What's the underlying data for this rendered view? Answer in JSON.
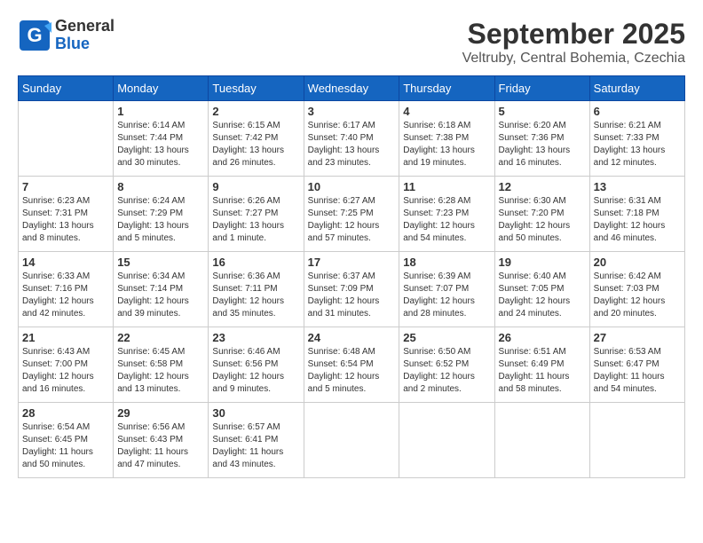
{
  "header": {
    "logo_general": "General",
    "logo_blue": "Blue",
    "month_title": "September 2025",
    "location": "Veltruby, Central Bohemia, Czechia"
  },
  "calendar": {
    "days_of_week": [
      "Sunday",
      "Monday",
      "Tuesday",
      "Wednesday",
      "Thursday",
      "Friday",
      "Saturday"
    ],
    "weeks": [
      [
        {
          "day": "",
          "info": ""
        },
        {
          "day": "1",
          "info": "Sunrise: 6:14 AM\nSunset: 7:44 PM\nDaylight: 13 hours\nand 30 minutes."
        },
        {
          "day": "2",
          "info": "Sunrise: 6:15 AM\nSunset: 7:42 PM\nDaylight: 13 hours\nand 26 minutes."
        },
        {
          "day": "3",
          "info": "Sunrise: 6:17 AM\nSunset: 7:40 PM\nDaylight: 13 hours\nand 23 minutes."
        },
        {
          "day": "4",
          "info": "Sunrise: 6:18 AM\nSunset: 7:38 PM\nDaylight: 13 hours\nand 19 minutes."
        },
        {
          "day": "5",
          "info": "Sunrise: 6:20 AM\nSunset: 7:36 PM\nDaylight: 13 hours\nand 16 minutes."
        },
        {
          "day": "6",
          "info": "Sunrise: 6:21 AM\nSunset: 7:33 PM\nDaylight: 13 hours\nand 12 minutes."
        }
      ],
      [
        {
          "day": "7",
          "info": "Sunrise: 6:23 AM\nSunset: 7:31 PM\nDaylight: 13 hours\nand 8 minutes."
        },
        {
          "day": "8",
          "info": "Sunrise: 6:24 AM\nSunset: 7:29 PM\nDaylight: 13 hours\nand 5 minutes."
        },
        {
          "day": "9",
          "info": "Sunrise: 6:26 AM\nSunset: 7:27 PM\nDaylight: 13 hours\nand 1 minute."
        },
        {
          "day": "10",
          "info": "Sunrise: 6:27 AM\nSunset: 7:25 PM\nDaylight: 12 hours\nand 57 minutes."
        },
        {
          "day": "11",
          "info": "Sunrise: 6:28 AM\nSunset: 7:23 PM\nDaylight: 12 hours\nand 54 minutes."
        },
        {
          "day": "12",
          "info": "Sunrise: 6:30 AM\nSunset: 7:20 PM\nDaylight: 12 hours\nand 50 minutes."
        },
        {
          "day": "13",
          "info": "Sunrise: 6:31 AM\nSunset: 7:18 PM\nDaylight: 12 hours\nand 46 minutes."
        }
      ],
      [
        {
          "day": "14",
          "info": "Sunrise: 6:33 AM\nSunset: 7:16 PM\nDaylight: 12 hours\nand 42 minutes."
        },
        {
          "day": "15",
          "info": "Sunrise: 6:34 AM\nSunset: 7:14 PM\nDaylight: 12 hours\nand 39 minutes."
        },
        {
          "day": "16",
          "info": "Sunrise: 6:36 AM\nSunset: 7:11 PM\nDaylight: 12 hours\nand 35 minutes."
        },
        {
          "day": "17",
          "info": "Sunrise: 6:37 AM\nSunset: 7:09 PM\nDaylight: 12 hours\nand 31 minutes."
        },
        {
          "day": "18",
          "info": "Sunrise: 6:39 AM\nSunset: 7:07 PM\nDaylight: 12 hours\nand 28 minutes."
        },
        {
          "day": "19",
          "info": "Sunrise: 6:40 AM\nSunset: 7:05 PM\nDaylight: 12 hours\nand 24 minutes."
        },
        {
          "day": "20",
          "info": "Sunrise: 6:42 AM\nSunset: 7:03 PM\nDaylight: 12 hours\nand 20 minutes."
        }
      ],
      [
        {
          "day": "21",
          "info": "Sunrise: 6:43 AM\nSunset: 7:00 PM\nDaylight: 12 hours\nand 16 minutes."
        },
        {
          "day": "22",
          "info": "Sunrise: 6:45 AM\nSunset: 6:58 PM\nDaylight: 12 hours\nand 13 minutes."
        },
        {
          "day": "23",
          "info": "Sunrise: 6:46 AM\nSunset: 6:56 PM\nDaylight: 12 hours\nand 9 minutes."
        },
        {
          "day": "24",
          "info": "Sunrise: 6:48 AM\nSunset: 6:54 PM\nDaylight: 12 hours\nand 5 minutes."
        },
        {
          "day": "25",
          "info": "Sunrise: 6:50 AM\nSunset: 6:52 PM\nDaylight: 12 hours\nand 2 minutes."
        },
        {
          "day": "26",
          "info": "Sunrise: 6:51 AM\nSunset: 6:49 PM\nDaylight: 11 hours\nand 58 minutes."
        },
        {
          "day": "27",
          "info": "Sunrise: 6:53 AM\nSunset: 6:47 PM\nDaylight: 11 hours\nand 54 minutes."
        }
      ],
      [
        {
          "day": "28",
          "info": "Sunrise: 6:54 AM\nSunset: 6:45 PM\nDaylight: 11 hours\nand 50 minutes."
        },
        {
          "day": "29",
          "info": "Sunrise: 6:56 AM\nSunset: 6:43 PM\nDaylight: 11 hours\nand 47 minutes."
        },
        {
          "day": "30",
          "info": "Sunrise: 6:57 AM\nSunset: 6:41 PM\nDaylight: 11 hours\nand 43 minutes."
        },
        {
          "day": "",
          "info": ""
        },
        {
          "day": "",
          "info": ""
        },
        {
          "day": "",
          "info": ""
        },
        {
          "day": "",
          "info": ""
        }
      ]
    ]
  }
}
